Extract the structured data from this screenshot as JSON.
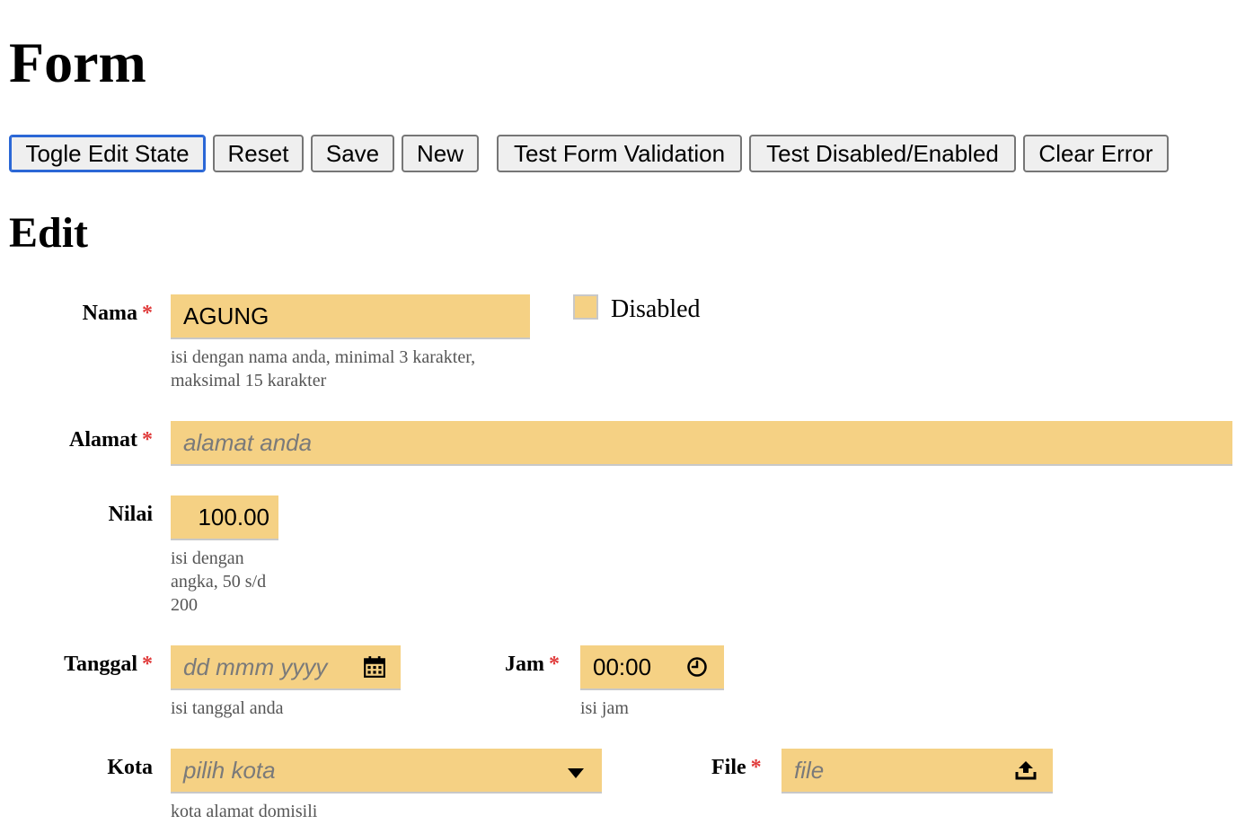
{
  "page": {
    "title": "Form",
    "subtitle": "Edit"
  },
  "toolbar": {
    "toggle_edit": "Togle Edit State",
    "reset": "Reset",
    "save": "Save",
    "new": "New",
    "test_validation": "Test Form Validation",
    "test_disabled": "Test Disabled/Enabled",
    "clear_error": "Clear Error"
  },
  "form": {
    "required_mark": "*",
    "nama": {
      "label": "Nama",
      "value": "AGUNG",
      "hint": "isi dengan nama anda, minimal 3 karakter, maksimal 15 karakter"
    },
    "disabled": {
      "label": "Disabled",
      "checked": false
    },
    "alamat": {
      "label": "Alamat",
      "placeholder": "alamat anda"
    },
    "nilai": {
      "label": "Nilai",
      "value": "100.00",
      "hint": "isi dengan angka, 50 s/d 200"
    },
    "tanggal": {
      "label": "Tanggal",
      "placeholder": "dd mmm yyyy",
      "hint": "isi tanggal anda",
      "icon": "calendar-icon"
    },
    "jam": {
      "label": "Jam",
      "value": "00:00",
      "hint": "isi jam",
      "icon": "clock-icon"
    },
    "kota": {
      "label": "Kota",
      "placeholder": "pilih kota",
      "hint": "kota alamat domisili",
      "icon": "caret-down-icon"
    },
    "file": {
      "label": "File",
      "placeholder": "file",
      "icon": "upload-icon"
    }
  },
  "colors": {
    "field_bg": "#f5d184",
    "required": "#e03a3a",
    "focus": "#2b67d6"
  }
}
